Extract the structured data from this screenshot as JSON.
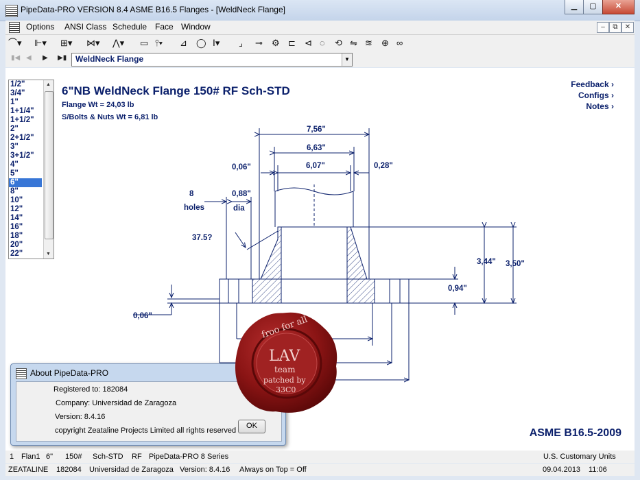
{
  "window": {
    "title": "PipeData-PRO VERSION 8.4 ASME B16.5 Flanges - [WeldNeck Flange]"
  },
  "menu": [
    "Options",
    "ANSI Class",
    "Schedule",
    "Face",
    "Window"
  ],
  "nav": {
    "selected": "WeldNeck Flange"
  },
  "sizes": [
    "1/2\"",
    "3/4\"",
    "1\"",
    "1+1/4\"",
    "1+1/2\"",
    "2\"",
    "2+1/2\"",
    "3\"",
    "3+1/2\"",
    "4\"",
    "5\"",
    "6\"",
    "8\"",
    "10\"",
    "12\"",
    "14\"",
    "16\"",
    "18\"",
    "20\"",
    "22\""
  ],
  "selected_size": "6\"",
  "drawing": {
    "title": "6\"NB WeldNeck Flange 150# RF Sch-STD",
    "flange_wt": "Flange Wt = 24,03 lb",
    "bolts_wt": "S/Bolts & Nuts Wt = 6,81 lb",
    "links": [
      "Feedback",
      "Configs",
      "Notes"
    ],
    "standard": "ASME B16.5-2009",
    "dims": {
      "d756": "7,56\"",
      "d663": "6,63\"",
      "d607": "6,07\"",
      "d006a": "0,06\"",
      "d028": "0,28\"",
      "holes_n": "8",
      "holes": "holes",
      "d088": "0,88\"",
      "dia": "dia",
      "angle": "37.5?",
      "d344": "3,44\"",
      "d350": "3,50\"",
      "d094": "0,94\"",
      "d006b": "0,06\""
    }
  },
  "status1": {
    "num": "1",
    "id": "Flan1",
    "size": "6\"",
    "cls": "150#",
    "sch": "Sch-STD",
    "face": "RF",
    "series": "PipeData-PRO 8 Series",
    "units": "U.S. Customary Units"
  },
  "status2": {
    "company": "ZEATALINE",
    "reg": "182084",
    "univ": "Universidad de Zaragoza",
    "version": "Version: 8.4.16",
    "ontop": "Always on Top = Off",
    "date": "09.04.2013",
    "time": "11:06"
  },
  "about": {
    "title": "About PipeData-PRO",
    "registered": "Registered to: 182084",
    "company": "Company: Universidad de Zaragoza",
    "version": "Version: 8.4.16",
    "copyright": "copyright Zeataline Projects Limited all rights reserved",
    "ok": "OK"
  },
  "seal": {
    "top": "froo for all",
    "lav": "LAV",
    "team": "team",
    "patched": "patched by",
    "code": "33C0"
  }
}
